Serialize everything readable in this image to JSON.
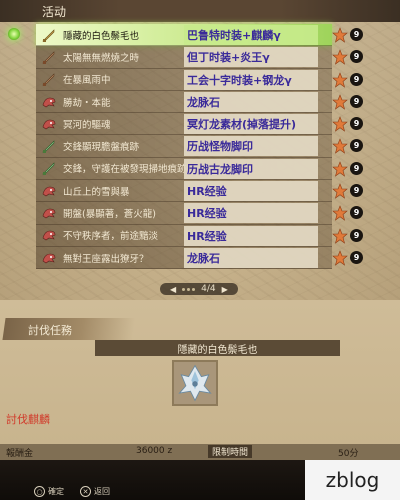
{
  "header": {
    "tab_title": "活动"
  },
  "quests": [
    {
      "name": "隱藏的白色鬃毛也",
      "reward": "巴鲁特时装+麒麟γ",
      "stars": "9",
      "icon": "gold-sword-icon",
      "selected": true
    },
    {
      "name": "太陽無無燃燒之時",
      "reward": "但丁时装+炎王γ",
      "stars": "9",
      "icon": "sword-icon",
      "selected": false
    },
    {
      "name": "在暴風雨中",
      "reward": "工会十字时装+钢龙γ",
      "stars": "9",
      "icon": "sword-icon",
      "selected": false
    },
    {
      "name": "勝劫・本能",
      "reward": "龙脉石",
      "stars": "9",
      "icon": "monster-head-icon",
      "selected": false
    },
    {
      "name": "冥河的驅魂",
      "reward": "冥灯龙素材(掉落提升)",
      "stars": "9",
      "icon": "monster-head-icon",
      "selected": false
    },
    {
      "name": "交鋒顯現膽盤痕跡",
      "reward": "历战怪物脚印",
      "stars": "9",
      "icon": "green-sword-icon",
      "selected": false
    },
    {
      "name": "交鋒，守護在被發現掃地痕跡",
      "reward": "历战古龙脚印",
      "stars": "9",
      "icon": "green-sword-icon",
      "selected": false
    },
    {
      "name": "山丘上的雪與暴",
      "reward": "HR经验",
      "stars": "9",
      "icon": "monster-head-icon",
      "selected": false
    },
    {
      "name": "開盤(暴顯著，蒼火龍)",
      "reward": "HR经验",
      "stars": "9",
      "icon": "monster-head-icon",
      "selected": false
    },
    {
      "name": "不守秩序者，前途黯淡",
      "reward": "HR经验",
      "stars": "9",
      "icon": "monster-head-icon",
      "selected": false
    },
    {
      "name": "無對王座露出獠牙？",
      "reward": "龙脉石",
      "stars": "9",
      "icon": "monster-head-icon",
      "selected": false
    }
  ],
  "pager": {
    "label": "4/4"
  },
  "detail": {
    "section_title": "討伐任務",
    "quest_title": "隱藏的白色鬃毛也",
    "quest_type": "討伐麒麟",
    "monster_icon": "kirin-icon",
    "money_label": "報酬金",
    "money_value": "36000 z",
    "limit_label": "限制時間",
    "limit_value": "50分"
  },
  "footer": {
    "confirm_label": "確定",
    "back_label": "返回",
    "watermark": "zblog"
  },
  "colors": {
    "selected_row": "#c8e98a",
    "reward_text": "#3a2a9a",
    "star": "#e07a3a",
    "quest_type": "#d13a2a"
  }
}
